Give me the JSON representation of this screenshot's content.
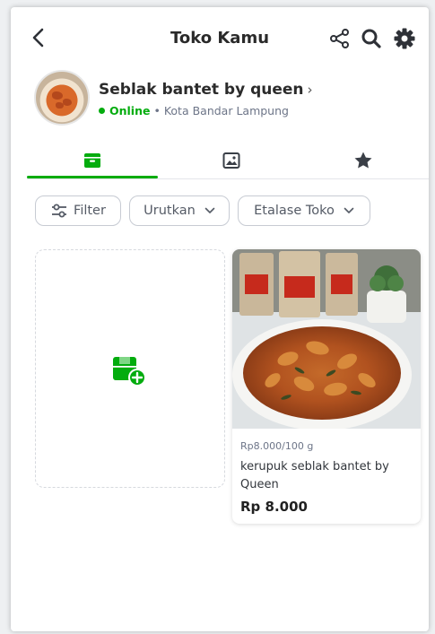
{
  "header": {
    "title": "Toko Kamu",
    "back_icon": "chevron-left-icon",
    "share_icon": "share-icon",
    "search_icon": "search-icon",
    "settings_icon": "gear-icon"
  },
  "shop": {
    "name": "Seblak bantet by queen",
    "name_chevron": "›",
    "status": "Online",
    "separator": "•",
    "location": "Kota Bandar Lampung",
    "status_color": "#03ac0e"
  },
  "tabs": [
    {
      "name": "products",
      "icon": "storefront-icon",
      "active": true
    },
    {
      "name": "showcase",
      "icon": "image-icon",
      "active": false
    },
    {
      "name": "reviews",
      "icon": "star-icon",
      "active": false
    }
  ],
  "filters": {
    "filter_label": "Filter",
    "sort_label": "Urutkan",
    "etalase_label": "Etalase Toko"
  },
  "add_product": {
    "icon": "add-product-icon"
  },
  "products": [
    {
      "price_unit": "Rp8.000/100 g",
      "name": "kerupuk seblak bantet by Queen",
      "price": "Rp 8.000"
    }
  ],
  "colors": {
    "accent": "#03ac0e",
    "icon_dark": "#2e3137"
  }
}
